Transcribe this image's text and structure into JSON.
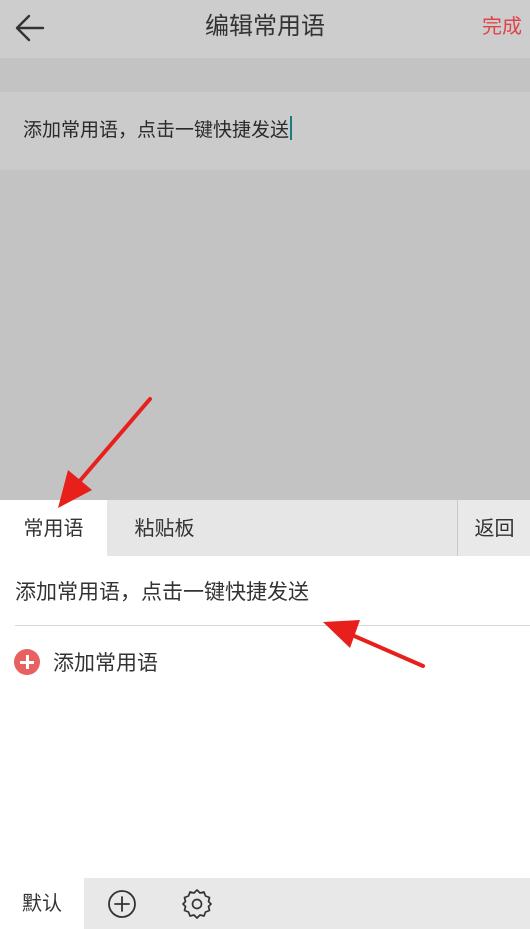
{
  "header": {
    "title": "编辑常用语",
    "done_label": "完成",
    "back_icon": "arrow-left-icon"
  },
  "editor": {
    "text": "添加常用语，点击一键快捷发送"
  },
  "tabs": [
    {
      "label": "常用语",
      "active": true
    },
    {
      "label": "粘贴板",
      "active": false
    }
  ],
  "return_label": "返回",
  "phrases": [
    {
      "text": "添加常用语，点击一键快捷发送"
    }
  ],
  "add_phrase_label": "添加常用语",
  "bottom_bar": {
    "default_label": "默认",
    "add_icon": "circle-plus-icon",
    "settings_icon": "gear-icon"
  },
  "colors": {
    "accent": "#e0444a",
    "add_icon": "#e8605f",
    "annotation_arrow": "#e8201c",
    "cursor": "#1c7c82"
  }
}
